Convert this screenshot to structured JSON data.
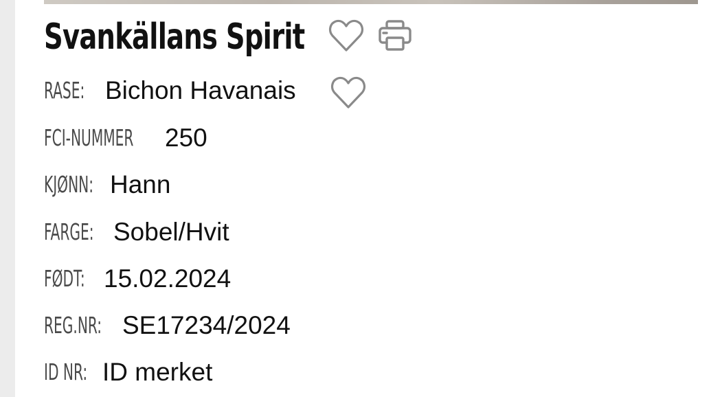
{
  "dog": {
    "name": "Svankällans Spirit"
  },
  "icons": {
    "favorite": "heart-outline-icon",
    "print": "printer-icon",
    "breed_favorite": "heart-outline-icon"
  },
  "details": [
    {
      "label": "RASE:",
      "value": "Bichon Havanais"
    },
    {
      "label": "FCI-NUMMER",
      "value": "250"
    },
    {
      "label": "KJØNN:",
      "value": "Hann"
    },
    {
      "label": "FARGE:",
      "value": "Sobel/Hvit"
    },
    {
      "label": "FØDT:",
      "value": "15.02.2024"
    },
    {
      "label": "REG.NR:",
      "value": "SE17234/2024"
    },
    {
      "label": "ID NR:",
      "value": "ID merket"
    }
  ],
  "colors": {
    "text": "#111111",
    "label": "#4a4a4a",
    "icon": "#8a8a8a",
    "gutter": "#ececec"
  }
}
